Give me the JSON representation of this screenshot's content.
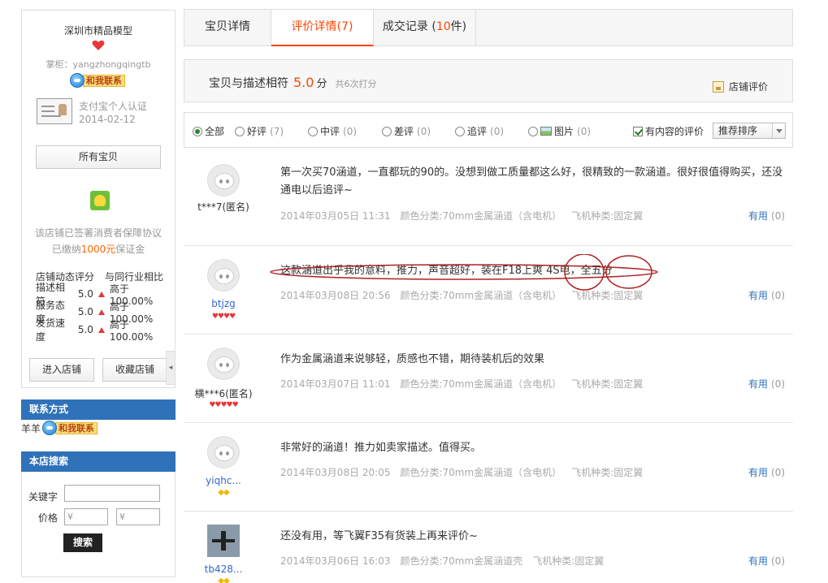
{
  "shop": {
    "name": "深圳市精品模型",
    "owner": "掌柜：yangzhongqingtb",
    "contact_label": "和我联系",
    "cert_line1": "支付宝个人认证",
    "cert_line2": "2014-02-12",
    "all_items": "所有宝贝",
    "guarantee_line1": "该店铺已签署消费者保障协议",
    "guarantee_pre": "已缴纳",
    "guarantee_amount": "1000元",
    "guarantee_post": "保证金",
    "dsr_header_left": "店铺动态评分",
    "dsr_header_right": "与同行业相比",
    "dsr": [
      {
        "label": "描述相符",
        "score": "5.0",
        "compare": "高于100.00%"
      },
      {
        "label": "服务态度",
        "score": "5.0",
        "compare": "高于100.00%"
      },
      {
        "label": "发货速度",
        "score": "5.0",
        "compare": "高于100.00%"
      }
    ],
    "enter_shop": "进入店铺",
    "fav_shop": "收藏店铺",
    "collapse": "◂"
  },
  "contact_box": {
    "title": "联系方式",
    "person": "羊羊",
    "contact_label": "和我联系"
  },
  "search_box": {
    "title": "本店搜索",
    "keyword_label": "关键字",
    "price_label": "价格",
    "price_min_placeholder": "¥",
    "price_max_placeholder": "¥",
    "search_btn": "搜索"
  },
  "tabs": {
    "details": "宝贝详情",
    "reviews_label": "评价详情",
    "reviews_open": "(",
    "reviews_count": "7",
    "reviews_close": ")",
    "records_label": "成交记录 (",
    "records_count": "10",
    "records_suffix": "件)"
  },
  "summary": {
    "label": "宝贝与描述相符",
    "score": "5.0",
    "unit": "分",
    "count": "共6次打分",
    "shop_rating": "店铺评价"
  },
  "filters": {
    "all": "全部",
    "good": "好评",
    "good_count": "(7)",
    "neutral": "中评",
    "neutral_count": "(0)",
    "bad": "差评",
    "bad_count": "(0)",
    "append": "追评",
    "append_count": "(0)",
    "pics": "图片",
    "pics_count": "(0)",
    "has_content": "有内容的评价",
    "sort": "推荐排序"
  },
  "reviews": [
    {
      "name": "t***7(匿名)",
      "hearts": "",
      "text": "第一次买70涵道，一直都玩的90的。没想到做工质量都这么好，很精致的一款涵道。很好很值得购买，还没通电以后追评~",
      "date": "2014年03月05日 11:31",
      "color": "颜色分类:70mm金属涵道（含电机）",
      "kind": "飞机种类:固定翼",
      "useful": "有用",
      "useful_count": "(0)"
    },
    {
      "name": "btjzg",
      "hearts": "♥♥♥♥",
      "text": "这款涵道出乎我的意料，推力，声音超好，装在F18上爽 4S电，全五分",
      "date": "2014年03月08日 20:56",
      "color": "颜色分类:70mm金属涵道（含电机）",
      "kind": "飞机种类:固定翼",
      "useful": "有用",
      "useful_count": "(0)"
    },
    {
      "name": "横***6(匿名)",
      "hearts": "♥♥♥♥♥",
      "text": "作为金属涵道来说够轻，质感也不错，期待装机后的效果",
      "date": "2014年03月07日 11:01",
      "color": "颜色分类:70mm金属涵道（含电机）",
      "kind": "飞机种类:固定翼",
      "useful": "有用",
      "useful_count": "(0)"
    },
    {
      "name": "yiqhc...",
      "hearts": "◆◆",
      "text": "非常好的涵道！推力如卖家描述。值得买。",
      "date": "2014年03月08日 20:05",
      "color": "颜色分类:70mm金属涵道（含电机）",
      "kind": "飞机种类:固定翼",
      "useful": "有用",
      "useful_count": "(0)"
    },
    {
      "name": "tb428...",
      "hearts": "◆◆",
      "text": "还没有用，等飞翼F35有货装上再来评价~",
      "date": "2014年03月06日 16:03",
      "color": "颜色分类:70mm金属涵道壳",
      "kind": "飞机种类:固定翼",
      "useful": "有用",
      "useful_count": "(0)"
    }
  ]
}
